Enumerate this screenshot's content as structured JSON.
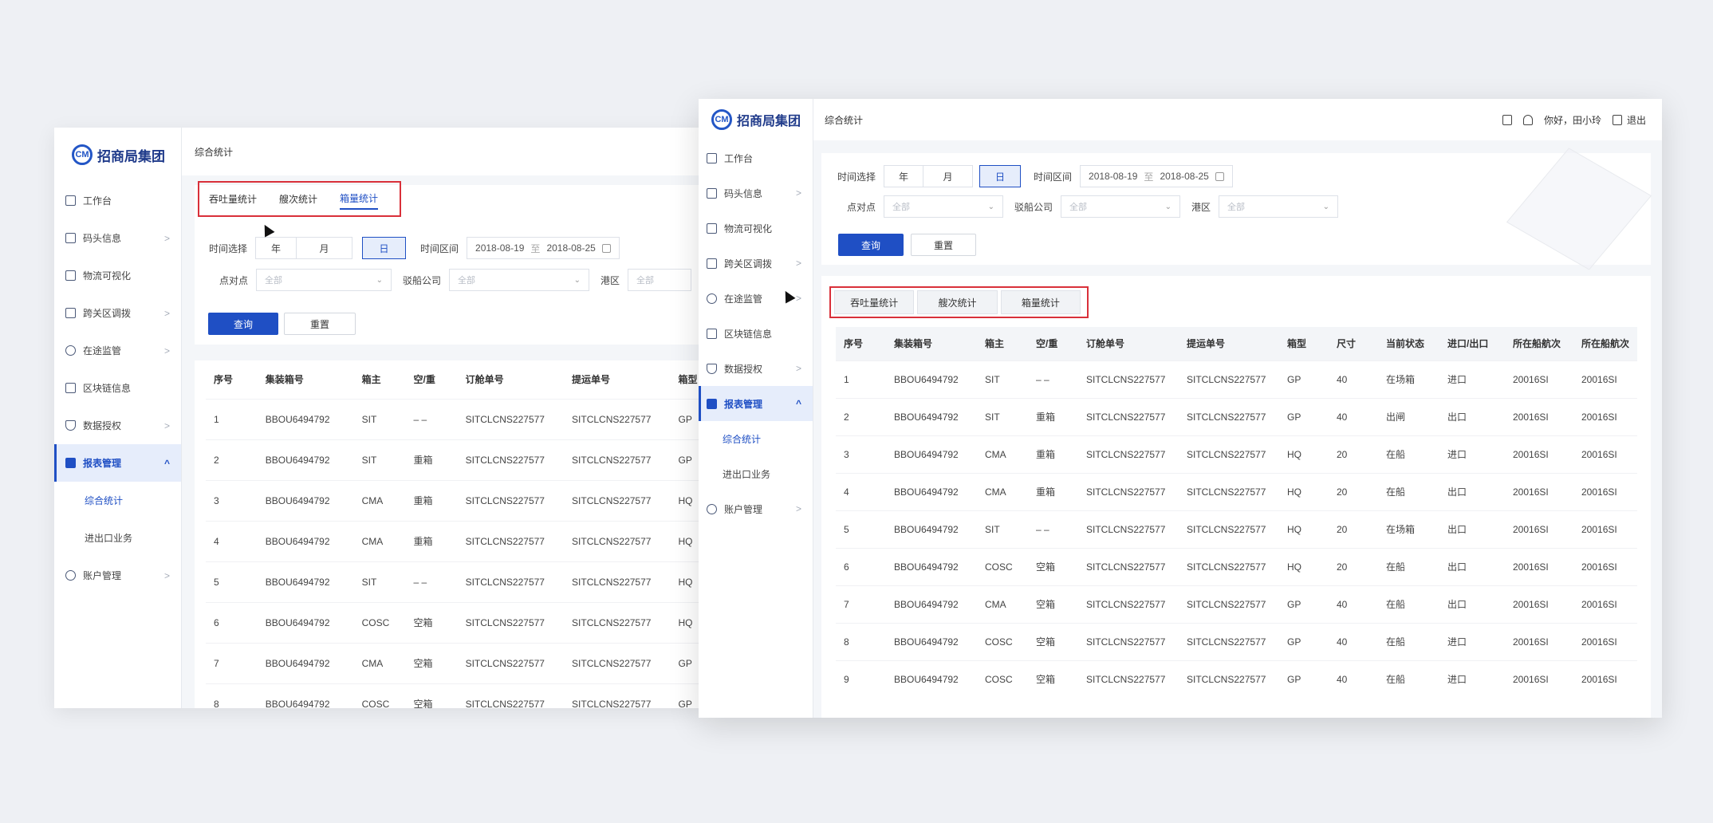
{
  "brand": {
    "logo_text": "招商局集团",
    "logo_mark": "CM"
  },
  "nav": [
    {
      "label": "工作台",
      "icon": "dashboard-icon",
      "arrow": false
    },
    {
      "label": "码头信息",
      "icon": "download-box-icon",
      "arrow": true
    },
    {
      "label": "物流可视化",
      "icon": "cube-icon",
      "arrow": false
    },
    {
      "label": "跨关区调拨",
      "icon": "document-icon",
      "arrow": true
    },
    {
      "label": "在途监管",
      "icon": "location-pin-icon",
      "arrow": true
    },
    {
      "label": "区块链信息",
      "icon": "blocks-icon",
      "arrow": false
    },
    {
      "label": "数据授权",
      "icon": "shield-icon",
      "arrow": true
    },
    {
      "label": "报表管理",
      "icon": "report-icon",
      "arrow": true,
      "expanded": true
    }
  ],
  "nav_sub": [
    "综合统计",
    "进出口业务"
  ],
  "nav_last": {
    "label": "账户管理",
    "icon": "account-icon"
  },
  "nav_up_arrow": "^",
  "nav_right_arrow": ">",
  "header": {
    "title": "综合统计",
    "greeting": "你好，田小玲",
    "logout": "退出"
  },
  "tabs": [
    "吞吐量统计",
    "艘次统计",
    "箱量统计"
  ],
  "filters": {
    "time_label": "时间选择",
    "periods": [
      "年",
      "月",
      "日"
    ],
    "active_period": "日",
    "range_label": "时间区间",
    "date_start": "2018-08-19",
    "date_sep": "至",
    "date_end": "2018-08-25",
    "point_label": "点对点",
    "ship_company_label": "驳船公司",
    "port_label": "港区",
    "all_placeholder": "全部",
    "chevron": "⌄"
  },
  "buttons": {
    "query": "查询",
    "reset": "重置"
  },
  "table": {
    "columns": [
      "序号",
      "集装箱号",
      "箱主",
      "空/重",
      "订舱单号",
      "提运单号",
      "箱型",
      "尺寸",
      "当前状态",
      "进口/出口",
      "所在船航次",
      "所在船航次"
    ],
    "rows": [
      [
        "1",
        "BBOU6494792",
        "SIT",
        "– –",
        "SITCLCNS227577",
        "SITCLCNS227577",
        "GP",
        "40",
        "在场箱",
        "进口",
        "20016SI",
        "20016SI"
      ],
      [
        "2",
        "BBOU6494792",
        "SIT",
        "重箱",
        "SITCLCNS227577",
        "SITCLCNS227577",
        "GP",
        "40",
        "出闸",
        "出口",
        "20016SI",
        "20016SI"
      ],
      [
        "3",
        "BBOU6494792",
        "CMA",
        "重箱",
        "SITCLCNS227577",
        "SITCLCNS227577",
        "HQ",
        "20",
        "在船",
        "进口",
        "20016SI",
        "20016SI"
      ],
      [
        "4",
        "BBOU6494792",
        "CMA",
        "重箱",
        "SITCLCNS227577",
        "SITCLCNS227577",
        "HQ",
        "20",
        "在船",
        "出口",
        "20016SI",
        "20016SI"
      ],
      [
        "5",
        "BBOU6494792",
        "SIT",
        "– –",
        "SITCLCNS227577",
        "SITCLCNS227577",
        "HQ",
        "20",
        "在场箱",
        "出口",
        "20016SI",
        "20016SI"
      ],
      [
        "6",
        "BBOU6494792",
        "COSC",
        "空箱",
        "SITCLCNS227577",
        "SITCLCNS227577",
        "HQ",
        "20",
        "在船",
        "出口",
        "20016SI",
        "20016SI"
      ],
      [
        "7",
        "BBOU6494792",
        "CMA",
        "空箱",
        "SITCLCNS227577",
        "SITCLCNS227577",
        "GP",
        "40",
        "在船",
        "出口",
        "20016SI",
        "20016SI"
      ],
      [
        "8",
        "BBOU6494792",
        "COSC",
        "空箱",
        "SITCLCNS227577",
        "SITCLCNS227577",
        "GP",
        "40",
        "在船",
        "进口",
        "20016SI",
        "20016SI"
      ],
      [
        "9",
        "BBOU6494792",
        "COSC",
        "空箱",
        "SITCLCNS227577",
        "SITCLCNS227577",
        "GP",
        "40",
        "在船",
        "进口",
        "20016SI",
        "20016SI"
      ]
    ]
  },
  "colors": {
    "primary": "#1f4fc4",
    "highlight_border": "#d9303a",
    "active_bg": "#e6edfb"
  }
}
